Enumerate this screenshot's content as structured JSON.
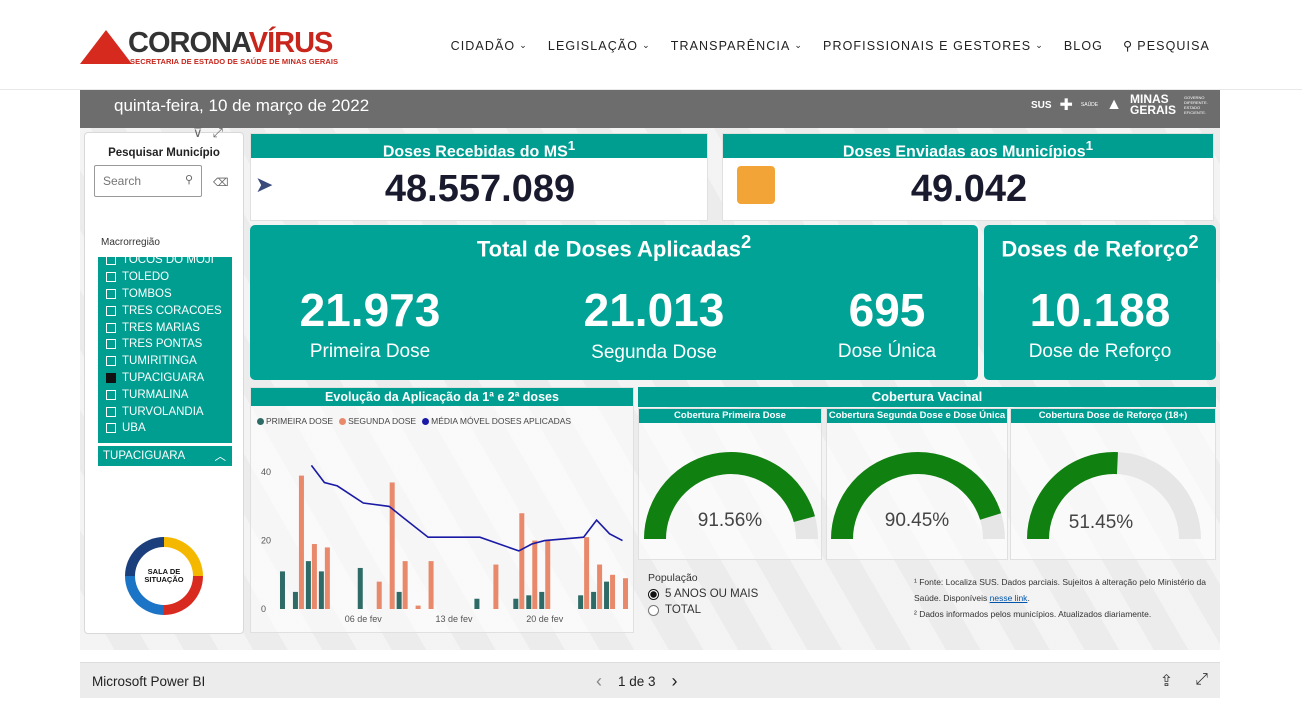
{
  "site": {
    "logo_main": "CORONA",
    "logo_accent": "VÍRUS",
    "logo_sub": "SECRETARIA DE ESTADO DE SAÚDE DE MINAS GERAIS",
    "nav": [
      "CIDADÃO",
      "LEGISLAÇÃO",
      "TRANSPARÊNCIA",
      "PROFISSIONAIS E GESTORES",
      "BLOG",
      "PESQUISA"
    ]
  },
  "report": {
    "date": "quinta-feira, 10 de março de 2022",
    "header_logos": {
      "sus": "SUS",
      "saude": "SAÚDE",
      "mg1": "MINAS",
      "mg2": "GERAIS",
      "mg_small": "GOVERNO DIFERENTE. ESTADO EFICIENTE."
    },
    "search": {
      "title": "Pesquisar Município",
      "placeholder": "Search"
    },
    "macro_label": "Macrorregião",
    "municipios": [
      {
        "name": "TOCOS DO MOJI",
        "checked": false
      },
      {
        "name": "TOLEDO",
        "checked": false
      },
      {
        "name": "TOMBOS",
        "checked": false
      },
      {
        "name": "TRES CORACOES",
        "checked": false
      },
      {
        "name": "TRES MARIAS",
        "checked": false
      },
      {
        "name": "TRES PONTAS",
        "checked": false
      },
      {
        "name": "TUMIRITINGA",
        "checked": false
      },
      {
        "name": "TUPACIGUARA",
        "checked": true
      },
      {
        "name": "TURMALINA",
        "checked": false
      },
      {
        "name": "TURVOLANDIA",
        "checked": false
      },
      {
        "name": "UBA",
        "checked": false
      }
    ],
    "selected_municipio": "TUPACIGUARA",
    "sala_label": "SALA DE SITUAÇÃO",
    "doses_recebidas": {
      "title": "Doses Recebidas do MS",
      "sup": "1",
      "value": "48.557.089"
    },
    "doses_enviadas": {
      "title": "Doses Enviadas aos Municípios",
      "sup": "1",
      "value": "49.042"
    },
    "total_aplicadas": {
      "title": "Total de Doses Aplicadas",
      "sup": "2",
      "primeira": {
        "value": "21.973",
        "label": "Primeira Dose"
      },
      "segunda": {
        "value": "21.013",
        "label": "Segunda Dose"
      },
      "unica": {
        "value": "695",
        "label": "Dose Única"
      }
    },
    "reforco": {
      "title": "Doses de Reforço",
      "sup": "2",
      "value": "10.188",
      "label": "Dose de Reforço"
    },
    "cobertura": {
      "title": "Cobertura Vacinal",
      "gauges": [
        {
          "title": "Cobertura Primeira Dose",
          "value": "91.56%",
          "fraction": 0.9156
        },
        {
          "title": "Cobertura Segunda Dose e Dose Única",
          "value": "90.45%",
          "fraction": 0.9045
        },
        {
          "title": "Cobertura Dose de Reforço (18+)",
          "value": "51.45%",
          "fraction": 0.5145
        }
      ],
      "accent": "#108010"
    },
    "populacao": {
      "label": "População",
      "options": [
        {
          "label": "5 ANOS OU MAIS",
          "selected": true
        },
        {
          "label": "TOTAL",
          "selected": false
        }
      ]
    },
    "notes": {
      "n1": "¹ Fonte: Localiza SUS. Dados parciais. Sujeitos à alteração pelo Ministério da Saúde. Disponíveis",
      "link": "nesse link",
      "n1_end": ".",
      "n2": "² Dados informados pelos municípios. Atualizados diariamente."
    }
  },
  "chart_data": {
    "type": "bar",
    "title": "Evolução da Aplicação da 1ª e 2ª doses",
    "legend": [
      "PRIMEIRA DOSE",
      "SEGUNDA DOSE",
      "MÉDIA MÓVEL DOSES APLICADAS"
    ],
    "colors": {
      "primeira": "#2e6b66",
      "segunda": "#e8896b",
      "media": "#1a1aa6"
    },
    "ylim": [
      0,
      50
    ],
    "yticks": [
      0,
      20,
      40
    ],
    "xticks": [
      "06 de fev",
      "13 de fev",
      "20 de fev"
    ],
    "days": [
      "31/01",
      "01/02",
      "02/02",
      "03/02",
      "04/02",
      "05/02",
      "06/02",
      "07/02",
      "08/02",
      "09/02",
      "10/02",
      "11/02",
      "12/02",
      "13/02",
      "14/02",
      "15/02",
      "16/02",
      "17/02",
      "18/02",
      "19/02",
      "20/02",
      "21/02",
      "22/02",
      "23/02",
      "24/02",
      "25/02",
      "26/02"
    ],
    "series": [
      {
        "name": "PRIMEIRA DOSE",
        "values": [
          11,
          5,
          14,
          11,
          0,
          0,
          12,
          0,
          0,
          5,
          0,
          0,
          0,
          0,
          0,
          3,
          0,
          0,
          3,
          4,
          5,
          0,
          0,
          4,
          5,
          8,
          0
        ]
      },
      {
        "name": "SEGUNDA DOSE",
        "values": [
          0,
          39,
          19,
          18,
          0,
          0,
          0,
          8,
          37,
          14,
          1,
          14,
          0,
          0,
          0,
          0,
          13,
          0,
          28,
          20,
          20,
          0,
          0,
          21,
          13,
          10,
          9
        ]
      },
      {
        "name": "MÉDIA MÓVEL DOSES APLICADAS",
        "values": [
          null,
          null,
          42,
          37,
          36,
          null,
          31,
          null,
          30,
          27,
          null,
          21,
          null,
          null,
          null,
          21,
          null,
          null,
          17,
          19,
          20,
          null,
          null,
          21,
          26,
          22,
          20
        ]
      }
    ]
  },
  "footer": {
    "brand": "Microsoft Power BI",
    "page": "1 de 3"
  }
}
